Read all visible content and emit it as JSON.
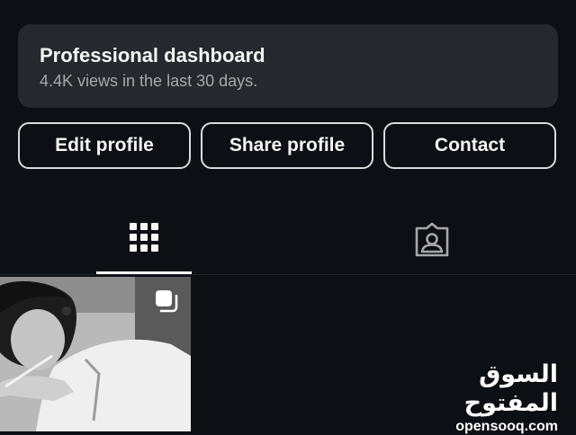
{
  "dashboard": {
    "title": "Professional dashboard",
    "subtitle": "4.4K views in the last 30 days."
  },
  "actions": {
    "edit_label": "Edit profile",
    "share_label": "Share profile",
    "contact_label": "Contact"
  },
  "tabs": [
    {
      "name": "posts-grid",
      "icon": "grid-icon",
      "selected": true
    },
    {
      "name": "tagged",
      "icon": "tagged-person-icon",
      "selected": false
    }
  ],
  "posts": [
    {
      "type": "carousel",
      "icon": "multiple-photos-icon"
    }
  ],
  "watermark": {
    "arabic": "السوق المفتوح",
    "latin": "opensooq.com"
  },
  "colors": {
    "background": "#0c1014",
    "card": "#25292e",
    "text": "#f5f5f5",
    "muted": "#a8a8a8",
    "button_border": "#dbdbdb"
  }
}
